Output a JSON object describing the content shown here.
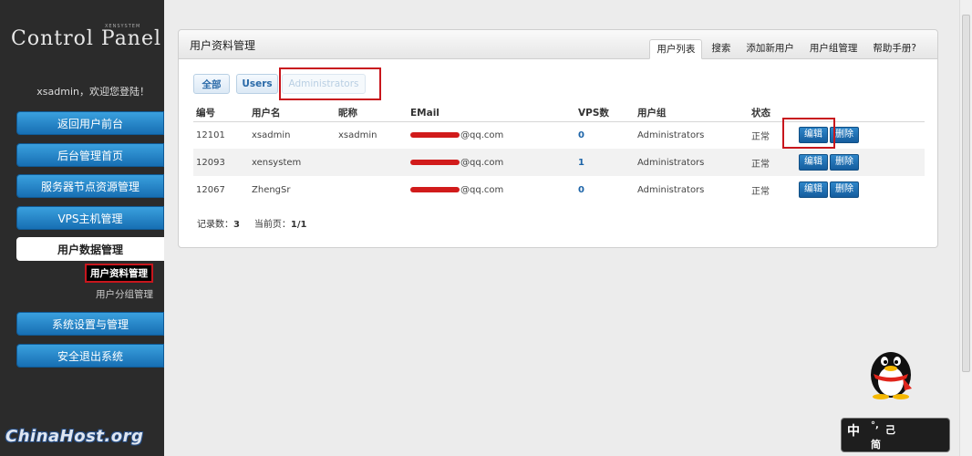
{
  "sidebar": {
    "brand": "Control Panel",
    "brand_small": "XENSYSTEM",
    "welcome": "xsadmin，欢迎您登陆！",
    "nav": [
      {
        "label": "返回用户前台"
      },
      {
        "label": "后台管理首页"
      },
      {
        "label": "服务器节点资源管理"
      },
      {
        "label": "VPS主机管理"
      },
      {
        "label": "用户数据管理"
      },
      {
        "label": "系统设置与管理"
      },
      {
        "label": "安全退出系统"
      }
    ],
    "sub": [
      {
        "label": "用户资料管理"
      },
      {
        "label": "用户分组管理"
      }
    ],
    "watermark": "ChinaHost.org"
  },
  "panel": {
    "title": "用户资料管理",
    "tabs": [
      "用户列表",
      "搜索",
      "添加新用户",
      "用户组管理",
      "帮助手册?"
    ],
    "filters": [
      "全部",
      "Users",
      "Administrators"
    ]
  },
  "table": {
    "headers": [
      "编号",
      "用户名",
      "昵称",
      "EMail",
      "VPS数",
      "用户组",
      "状态",
      ""
    ],
    "rows": [
      {
        "id": "12101",
        "username": "xsadmin",
        "nickname": "xsadmin",
        "email_suffix": "@qq.com",
        "vps": "0",
        "group": "Administrators",
        "status": "正常"
      },
      {
        "id": "12093",
        "username": "xensystem",
        "nickname": "",
        "email_suffix": "@qq.com",
        "vps": "1",
        "group": "Administrators",
        "status": "正常"
      },
      {
        "id": "12067",
        "username": "ZhengSr",
        "nickname": "",
        "email_suffix": "@qq.com",
        "vps": "0",
        "group": "Administrators",
        "status": "正常"
      }
    ],
    "edit_label": "编辑",
    "delete_label": "删除"
  },
  "footer": {
    "records_label": "记录数：",
    "records_value": "3",
    "page_label": "当前页：",
    "page_value": "1/1"
  },
  "ime": {
    "chars": [
      "中",
      "°,",
      "己",
      "简"
    ]
  },
  "colors": {
    "accent": "#1d6fb3",
    "highlight": "#c8161d",
    "sidebar_bg": "#2b2b2b"
  }
}
